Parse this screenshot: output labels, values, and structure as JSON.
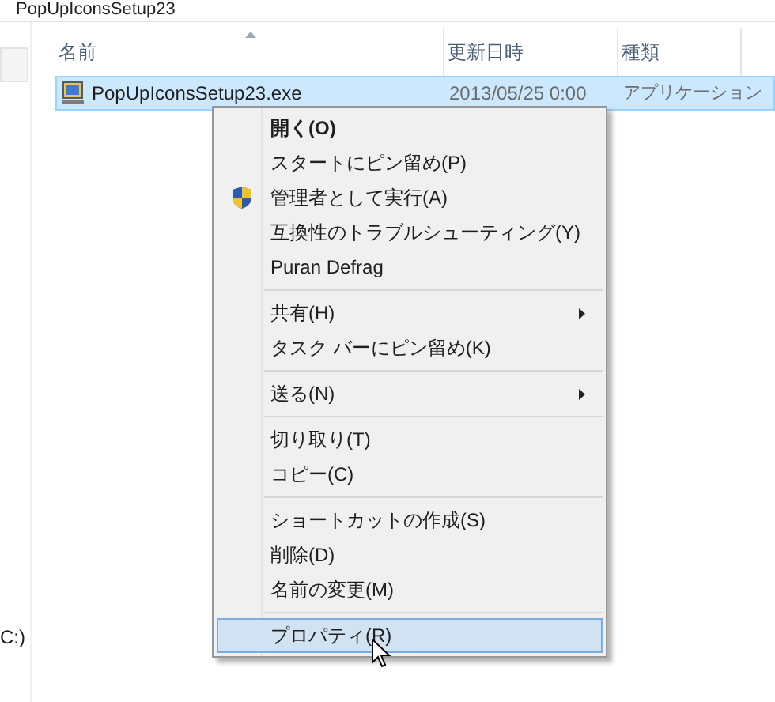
{
  "window": {
    "title": "PopUpIconsSetup23"
  },
  "nav_pane": {
    "items": [
      "C:)"
    ]
  },
  "file_list": {
    "columns": [
      {
        "label": "名前",
        "sorted": true
      },
      {
        "label": "更新日時",
        "sorted": false
      },
      {
        "label": "種類",
        "sorted": false
      }
    ],
    "rows": [
      {
        "name": "PopUpIconsSetup23.exe",
        "modified": "2013/05/25 0:00",
        "type": "アプリケーション",
        "selected": true
      }
    ]
  },
  "context_menu": {
    "items": [
      {
        "kind": "command",
        "label": "開く(O)",
        "default": true,
        "submenu": false,
        "selected": false
      },
      {
        "kind": "command",
        "label": "スタートにピン留め(P)",
        "default": false,
        "submenu": false,
        "selected": false
      },
      {
        "kind": "elevated",
        "label": "管理者として実行(A)",
        "default": false,
        "submenu": false,
        "selected": false
      },
      {
        "kind": "command",
        "label": "互換性のトラブルシューティング(Y)",
        "default": false,
        "submenu": false,
        "selected": false
      },
      {
        "kind": "command",
        "label": "Puran Defrag",
        "default": false,
        "submenu": false,
        "selected": false
      },
      {
        "kind": "separator"
      },
      {
        "kind": "command",
        "label": "共有(H)",
        "default": false,
        "submenu": true,
        "selected": false
      },
      {
        "kind": "command",
        "label": "タスク バーにピン留め(K)",
        "default": false,
        "submenu": false,
        "selected": false
      },
      {
        "kind": "separator"
      },
      {
        "kind": "command",
        "label": "送る(N)",
        "default": false,
        "submenu": true,
        "selected": false
      },
      {
        "kind": "separator"
      },
      {
        "kind": "command",
        "label": "切り取り(T)",
        "default": false,
        "submenu": false,
        "selected": false
      },
      {
        "kind": "command",
        "label": "コピー(C)",
        "default": false,
        "submenu": false,
        "selected": false
      },
      {
        "kind": "separator"
      },
      {
        "kind": "command",
        "label": "ショートカットの作成(S)",
        "default": false,
        "submenu": false,
        "selected": false
      },
      {
        "kind": "command",
        "label": "削除(D)",
        "default": false,
        "submenu": false,
        "selected": false
      },
      {
        "kind": "command",
        "label": "名前の変更(M)",
        "default": false,
        "submenu": false,
        "selected": false
      },
      {
        "kind": "separator"
      },
      {
        "kind": "command",
        "label": "プロパティ(R)",
        "default": false,
        "submenu": false,
        "selected": true
      }
    ]
  }
}
